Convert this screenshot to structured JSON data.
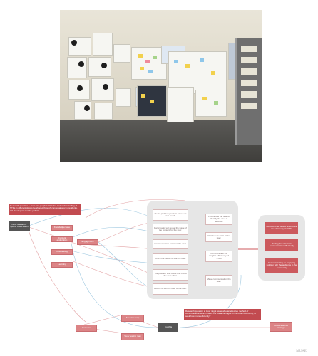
{
  "photo": {
    "description_icon": "photo-of-research-wall"
  },
  "diagram": {
    "rq1": "Research question 1: How can people's attitudes and understanding of STPs in different places be shaped through conversations by residents, UX developers and the public?",
    "rq2": "Research question 2: How might we enable an effective method of communication which makes the full advantages of the local community, to seek how more efficiently?",
    "start_node": "Desk research / Quant. observation",
    "left_nodes": [
      "Knowledge base",
      "Content exploration",
      "Cost testing",
      "Learning"
    ],
    "engagement_node": "Engagement",
    "bottom_nodes": [
      "Scenario map",
      "Story testing map"
    ],
    "outcome_node": "Outcome",
    "insights_node": "Insights",
    "far_right_node": "Conversational strategy",
    "center_cards_left": [
      "Ideate problem problem based on user needs.",
      "Participants will reveal the issue of the consent for the user.",
      "Communication between the user.",
      "Which the needs to use the user.",
      "The problem with users and this is the user what.",
      "People to feel the user of the user."
    ],
    "center_cards_right": [
      "People use the task to identify the user to describe.",
      "Which is the task of the user.",
      "Communicate the insights effectively of STPs",
      "Make communication the user."
    ],
    "right_cards": [
      "Communicate based on improve the efficiency of STPs",
      "Testing the solution's communication effectively",
      "Communicating an engaging solution with the audience in the community"
    ],
    "credit": "MUAE"
  }
}
